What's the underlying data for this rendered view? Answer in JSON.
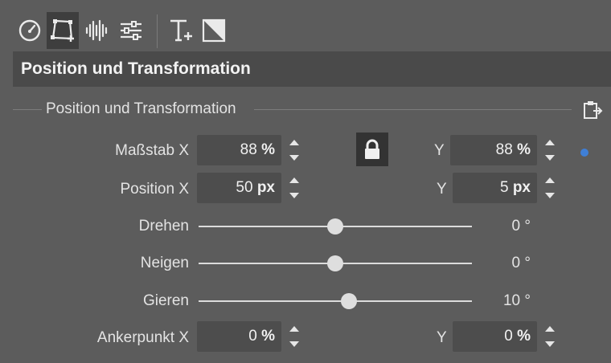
{
  "toolbar": {
    "icons": [
      "speedometer-icon",
      "crop-transform-icon",
      "audio-waveform-icon",
      "sliders-icon",
      "text-add-icon",
      "diagonal-mask-icon"
    ]
  },
  "header": {
    "title": "Position und Transformation"
  },
  "section": {
    "title": "Position und Transformation",
    "scale": {
      "label": "Maßstab X",
      "x_value": "88",
      "x_unit": "%",
      "y_label": "Y",
      "y_value": "88",
      "y_unit": "%"
    },
    "position": {
      "label": "Position X",
      "x_value": "50",
      "x_unit": "px",
      "y_label": "Y",
      "y_value": "5",
      "y_unit": "px"
    },
    "rotate": {
      "label": "Drehen",
      "value": "0 °",
      "level": 0.5
    },
    "skew": {
      "label": "Neigen",
      "value": "0 °",
      "level": 0.5
    },
    "yaw": {
      "label": "Gieren",
      "value": "10 °",
      "level": 0.55
    },
    "anchor": {
      "label": "Ankerpunkt X",
      "x_value": "0",
      "x_unit": "%",
      "y_label": "Y",
      "y_value": "0",
      "y_unit": "%"
    }
  },
  "colors": {
    "accent": "#3f7fd6",
    "panel": "#5c5c5c",
    "header": "#4a4a4a"
  }
}
